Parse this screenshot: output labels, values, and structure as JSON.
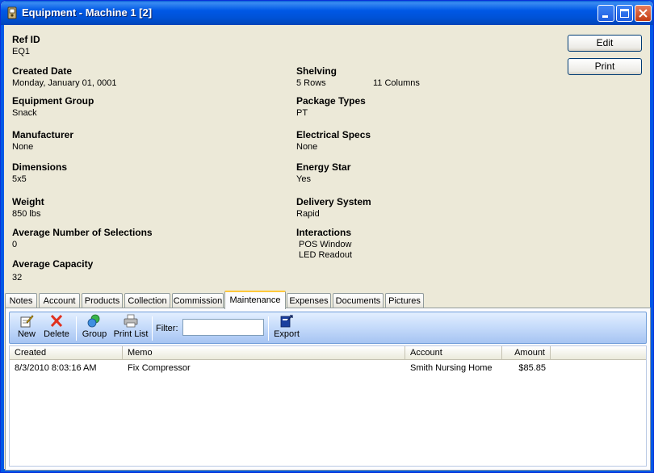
{
  "window": {
    "title": "Equipment - Machine 1 [2]"
  },
  "fields": {
    "ref_id": {
      "label": "Ref ID",
      "value": "EQ1"
    },
    "created_date": {
      "label": "Created Date",
      "value": "Monday, January 01, 0001"
    },
    "equipment_group": {
      "label": "Equipment Group",
      "value": "Snack"
    },
    "manufacturer": {
      "label": "Manufacturer",
      "value": "None"
    },
    "dimensions": {
      "label": "Dimensions",
      "value": "5x5"
    },
    "weight": {
      "label": "Weight",
      "value": "850 lbs"
    },
    "avg_selections": {
      "label": "Average Number of Selections",
      "value": "0"
    },
    "avg_capacity": {
      "label": "Average Capacity",
      "value": "32"
    },
    "shelving": {
      "label": "Shelving",
      "rows": "5 Rows",
      "columns": "11 Columns"
    },
    "package_types": {
      "label": "Package Types",
      "value": "PT"
    },
    "electrical_specs": {
      "label": "Electrical Specs",
      "value": "None"
    },
    "energy_star": {
      "label": "Energy Star",
      "value": "Yes"
    },
    "delivery_system": {
      "label": "Delivery System",
      "value": "Rapid"
    },
    "interactions": {
      "label": "Interactions",
      "values": [
        "POS Window",
        "LED Readout"
      ]
    }
  },
  "buttons": {
    "edit": "Edit",
    "print": "Print"
  },
  "tabs": [
    "Notes",
    "Account",
    "Products",
    "Collection",
    "Commission",
    "Maintenance",
    "Expenses",
    "Documents",
    "Pictures"
  ],
  "active_tab": "Maintenance",
  "toolbar": {
    "new": "New",
    "delete": "Delete",
    "group": "Group",
    "print_list": "Print List",
    "filter_label": "Filter:",
    "filter_value": "",
    "export": "Export"
  },
  "grid": {
    "columns": [
      "Created",
      "Memo",
      "Account",
      "Amount"
    ],
    "rows": [
      {
        "created": "8/3/2010 8:03:16 AM",
        "memo": "Fix Compressor",
        "account": "Smith Nursing Home",
        "amount": "$85.85"
      }
    ]
  },
  "colors": {
    "titlebar": "#0058e6",
    "window_bg": "#ece9d8",
    "active_tab_highlight": "#ffc83c",
    "toolbar": "#c4dafa"
  }
}
